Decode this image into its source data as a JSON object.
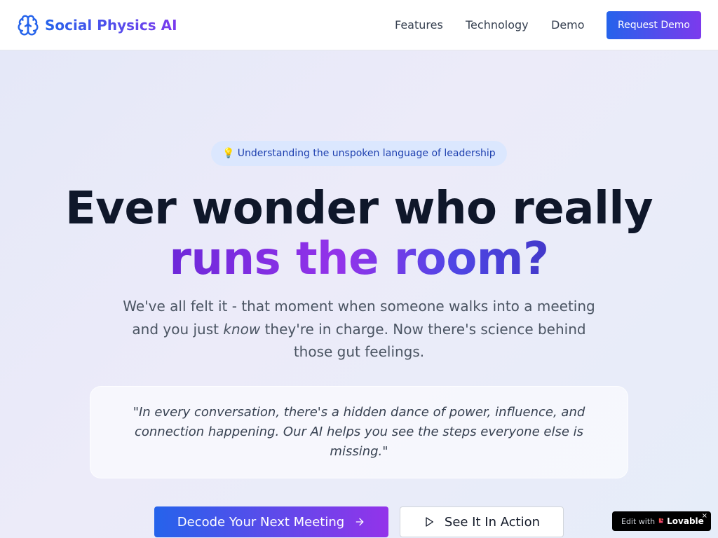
{
  "nav": {
    "brand": "Social Physics AI",
    "brand_icon": "brain-icon",
    "links": [
      "Features",
      "Technology",
      "Demo"
    ],
    "cta": "Request Demo"
  },
  "hero": {
    "badge_icon": "lightbulb-icon",
    "badge_text": "Understanding the unspoken language of leadership",
    "headline_line1": "Ever wonder who really",
    "headline_line2": "runs the room?",
    "subtext_before": "We've all felt it - that moment when someone walks into a meeting and you just ",
    "subtext_emphasis": "know",
    "subtext_after": " they're in charge. Now there's science behind those gut feelings.",
    "quote": "\"In every conversation, there's a hidden dance of power, influence, and connection happening. Our AI helps you see the steps everyone else is missing.\"",
    "primary_cta": "Decode Your Next Meeting",
    "primary_cta_icon": "arrow-right-icon",
    "secondary_cta": "See It In Action",
    "secondary_cta_icon": "play-icon"
  },
  "lovable_badge": {
    "prefix": "Edit with",
    "brand": "Lovable",
    "close": "×"
  },
  "colors": {
    "accent_start": "#2563eb",
    "accent_end": "#7c3aed",
    "headline": "#0f172a",
    "badge_bg": "#dbe7fe",
    "badge_text": "#1e40af"
  }
}
